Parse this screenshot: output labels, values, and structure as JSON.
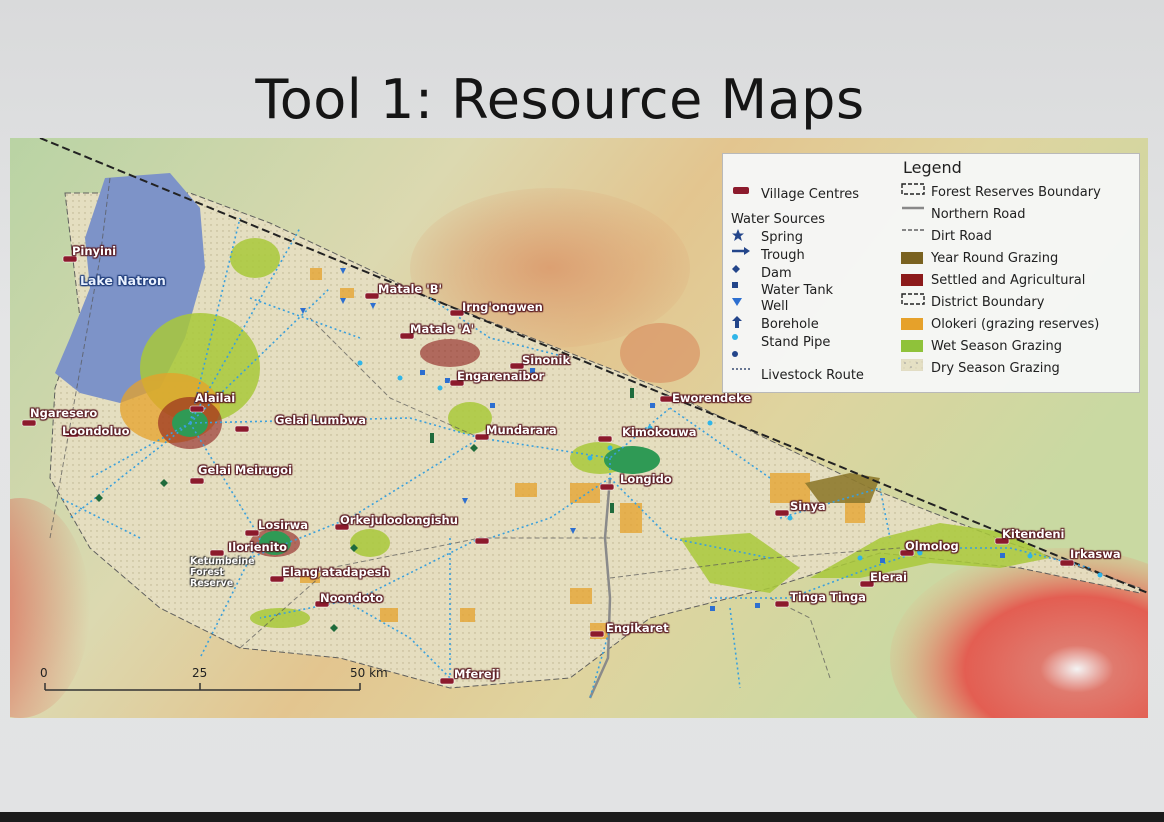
{
  "slide": {
    "title": "Tool 1: Resource Maps"
  },
  "legend": {
    "title": "Legend",
    "left_items": [
      {
        "symbol": "village-icon",
        "label": "Village Centres"
      },
      {
        "symbol": "none",
        "label": "Water Sources"
      },
      {
        "symbol": "star-icon",
        "label": "Spring"
      },
      {
        "symbol": "arrow-right-icon",
        "label": "Trough"
      },
      {
        "symbol": "diamond-icon",
        "label": "Dam"
      },
      {
        "symbol": "square-icon",
        "label": "Water Tank"
      },
      {
        "symbol": "triangle-down-icon",
        "label": "Well"
      },
      {
        "symbol": "arrow-up-icon",
        "label": "Borehole"
      },
      {
        "symbol": "circle-icon",
        "label": "Stand Pipe"
      },
      {
        "symbol": "dot-icon",
        "label": ""
      },
      {
        "symbol": "dotted-line-icon",
        "label": "Livestock Route"
      }
    ],
    "right_items": [
      {
        "symbol": "dashed-box",
        "label": "Forest Reserves Boundary"
      },
      {
        "symbol": "solid-line",
        "label": "Northern Road"
      },
      {
        "symbol": "dash-line",
        "label": "Dirt Road"
      },
      {
        "symbol": "fill",
        "color": "#7a6220",
        "label": "Year Round Grazing"
      },
      {
        "symbol": "fill",
        "color": "#8c1a1a",
        "label": "Settled and Agricultural"
      },
      {
        "symbol": "dashed-box",
        "label": "District Boundary"
      },
      {
        "symbol": "fill",
        "color": "#e6a12a",
        "label": "Olokeri (grazing reserves)"
      },
      {
        "symbol": "fill",
        "color": "#8fc23a",
        "label": "Wet Season Grazing"
      },
      {
        "symbol": "dotted-fill",
        "color": "#e4e0c4",
        "label": "Dry Season Grazing"
      }
    ]
  },
  "colors": {
    "village": "#8c1a2c",
    "water": "#2d6fd0",
    "standpipe": "#2fb5e8",
    "route": "#3aa0dc",
    "borehole": "#1f6b3c",
    "lake": "#7d93c8",
    "olokeri": "#e6a12a",
    "wet_grazing": "#a9c93a",
    "forest": "#2f9a55"
  },
  "places": [
    {
      "name": "Pinyini",
      "style": "village"
    },
    {
      "name": "Lake Natron",
      "style": "water"
    },
    {
      "name": "Matale 'B'",
      "style": "village"
    },
    {
      "name": "Irng'ongwen",
      "style": "village"
    },
    {
      "name": "Matale 'A'",
      "style": "village"
    },
    {
      "name": "Sinonik",
      "style": "village"
    },
    {
      "name": "Engarenaibor",
      "style": "village"
    },
    {
      "name": "Eworendeke",
      "style": "village"
    },
    {
      "name": "Ngaresero",
      "style": "village"
    },
    {
      "name": "Loondoluo",
      "style": "village"
    },
    {
      "name": "Alailai",
      "style": "village"
    },
    {
      "name": "Gelai Lumbwa",
      "style": "village"
    },
    {
      "name": "Mundarara",
      "style": "village"
    },
    {
      "name": "Kimokouwa",
      "style": "village"
    },
    {
      "name": "Gelai Meirugoi",
      "style": "village"
    },
    {
      "name": "Longido",
      "style": "village"
    },
    {
      "name": "Sinya",
      "style": "village"
    },
    {
      "name": "Losirwa",
      "style": "village"
    },
    {
      "name": "Orkejuloolongishu",
      "style": "village"
    },
    {
      "name": "Ilorienito",
      "style": "village"
    },
    {
      "name": "Elang'atadapesh",
      "style": "village"
    },
    {
      "name": "Noondoto",
      "style": "village"
    },
    {
      "name": "Kitendeni",
      "style": "village"
    },
    {
      "name": "Olmolog",
      "style": "village"
    },
    {
      "name": "Irkaswa",
      "style": "village"
    },
    {
      "name": "Elerai",
      "style": "village"
    },
    {
      "name": "Tinga Tinga",
      "style": "village"
    },
    {
      "name": "Engikaret",
      "style": "village"
    },
    {
      "name": "Mfereji",
      "style": "village"
    }
  ],
  "forest_reserve": {
    "line1": "Ketumbeine",
    "line2": "Forest",
    "line3": "Reserve"
  },
  "scale_bar": {
    "labels": [
      "0",
      "25",
      "50 km"
    ]
  }
}
